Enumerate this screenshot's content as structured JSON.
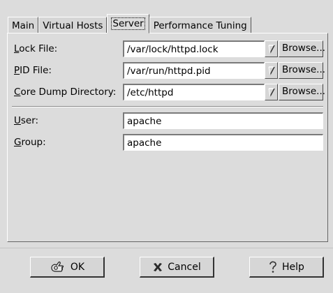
{
  "tabs": [
    {
      "label": "Main"
    },
    {
      "label": "Virtual Hosts"
    },
    {
      "label": "Server"
    },
    {
      "label": "Performance Tuning"
    }
  ],
  "active_tab": "Server",
  "fields": {
    "lock_file": {
      "label_mnemonic": "L",
      "label_rest": "ock File:",
      "value": "/var/lock/httpd.lock",
      "browse": "Browse..."
    },
    "pid_file": {
      "label_mnemonic": "P",
      "label_rest": "ID File:",
      "value": "/var/run/httpd.pid",
      "browse": "Browse..."
    },
    "core_dump": {
      "label_mnemonic": "C",
      "label_rest": "ore Dump Directory:",
      "value": "/etc/httpd",
      "browse": "Browse..."
    },
    "user": {
      "label_mnemonic": "U",
      "label_rest": "ser:",
      "value": "apache"
    },
    "group": {
      "label_mnemonic": "G",
      "label_rest": "roup:",
      "value": "apache"
    }
  },
  "buttons": {
    "ok": "OK",
    "cancel": "Cancel",
    "help": "Help"
  },
  "icons": {
    "ok": "ok-hand-icon",
    "cancel": "cross-icon",
    "help": "question-icon",
    "combo": "dropdown-arrow-icon"
  }
}
